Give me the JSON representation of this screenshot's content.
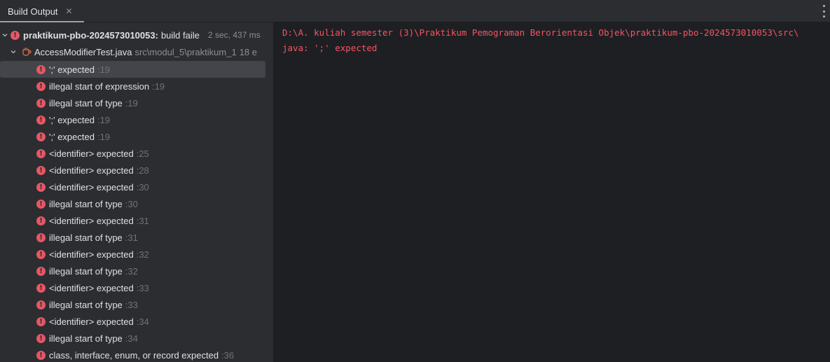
{
  "tab": {
    "label": "Build Output",
    "close_glyph": "✕"
  },
  "tree": {
    "root": {
      "name": "praktikum-pbo-2024573010053:",
      "status": "build faile",
      "time": "2 sec, 437 ms"
    },
    "file": {
      "name": "AccessModifierTest.java",
      "path": "src\\modul_5\\praktikum_1",
      "count": "18 e"
    },
    "errors": [
      {
        "msg": "';' expected",
        "line": ":19"
      },
      {
        "msg": "illegal start of expression",
        "line": ":19"
      },
      {
        "msg": "illegal start of type",
        "line": ":19"
      },
      {
        "msg": "';' expected",
        "line": ":19"
      },
      {
        "msg": "';' expected",
        "line": ":19"
      },
      {
        "msg": "<identifier> expected",
        "line": ":25"
      },
      {
        "msg": "<identifier> expected",
        "line": ":28"
      },
      {
        "msg": "<identifier> expected",
        "line": ":30"
      },
      {
        "msg": "illegal start of type",
        "line": ":30"
      },
      {
        "msg": "<identifier> expected",
        "line": ":31"
      },
      {
        "msg": "illegal start of type",
        "line": ":31"
      },
      {
        "msg": "<identifier> expected",
        "line": ":32"
      },
      {
        "msg": "illegal start of type",
        "line": ":32"
      },
      {
        "msg": "<identifier> expected",
        "line": ":33"
      },
      {
        "msg": "illegal start of type",
        "line": ":33"
      },
      {
        "msg": "<identifier> expected",
        "line": ":34"
      },
      {
        "msg": "illegal start of type",
        "line": ":34"
      },
      {
        "msg": "class, interface, enum, or record expected",
        "line": ":36"
      }
    ]
  },
  "console": {
    "lines": [
      "D:\\A. kuliah semester (3)\\Praktikum Pemograman Berorientasi Objek\\praktikum-pbo-2024573010053\\src\\",
      "java: ';' expected"
    ]
  },
  "colors": {
    "error": "#e55765",
    "console_text": "#f75464",
    "selected_row": "#43454a"
  },
  "icons": {
    "error": "error-icon",
    "file": "java-file-icon",
    "expand": "chevron-down-icon",
    "more": "more-vertical-icon"
  }
}
